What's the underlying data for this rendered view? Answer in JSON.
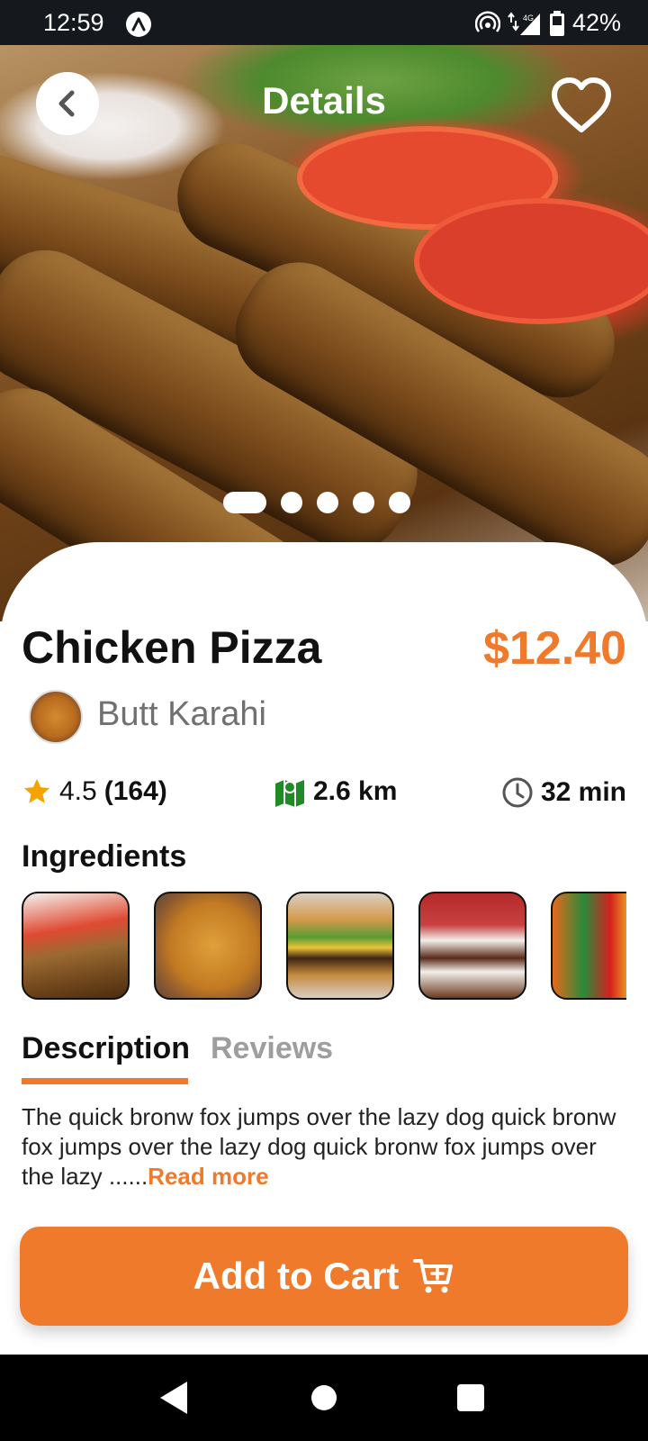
{
  "status_bar": {
    "time": "12:59",
    "network": "4G",
    "battery": "42%"
  },
  "header": {
    "title": "Details",
    "back_icon": "chevron-left-icon",
    "favorite_icon": "heart-outline-icon"
  },
  "carousel": {
    "total_dots": 5,
    "active_index": 0
  },
  "food": {
    "name": "Chicken Pizza",
    "price": "$12.40",
    "restaurant": "Butt Karahi"
  },
  "stats": {
    "rating": "4.5",
    "rating_count": "(164)",
    "distance": "2.6 km",
    "time": "32 min"
  },
  "ingredients": {
    "title": "Ingredients",
    "items": [
      "kebab",
      "biryani",
      "burger",
      "lava-cake",
      "soft-drinks"
    ]
  },
  "tabs": {
    "description": "Description",
    "reviews": "Reviews",
    "active": "description"
  },
  "description": {
    "text": "The quick bronw fox jumps over the lazy dog quick bronw fox jumps over the lazy dog quick bronw fox jumps over the lazy ......",
    "read_more": "Read more"
  },
  "cart": {
    "label": "Add to Cart",
    "icon": "cart-plus-icon"
  },
  "colors": {
    "accent": "#ef7a2c",
    "star": "#f5a300",
    "map": "#1f8a26",
    "text": "#111111",
    "muted": "#9e9e9e"
  }
}
